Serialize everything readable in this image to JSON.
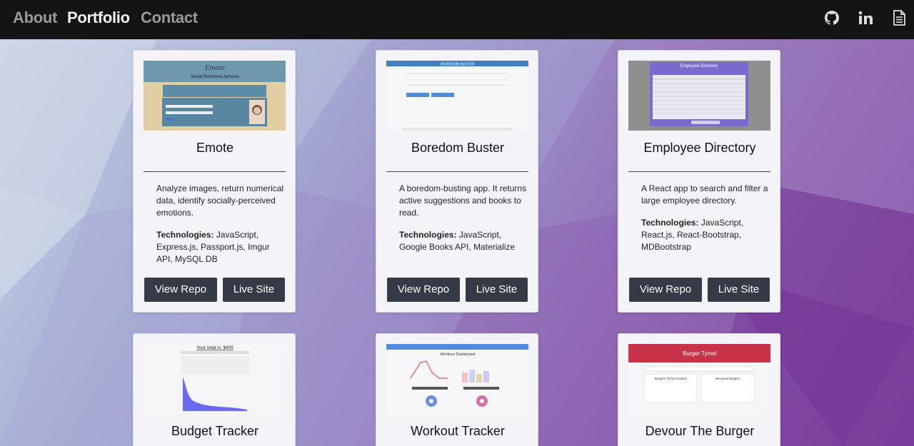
{
  "nav": {
    "links": [
      {
        "label": "About"
      },
      {
        "label": "Portfolio"
      },
      {
        "label": "Contact"
      }
    ],
    "icons": [
      "github-icon",
      "linkedin-icon",
      "resume-icon"
    ]
  },
  "colors": {
    "navbar_bg": "#141414",
    "button_bg": "#343a46",
    "card_bg": "#f4f4f8"
  },
  "projects": [
    {
      "title": "Emote",
      "description": "Analyze images, return numerical data, identify socially-perceived emotions.",
      "tech_label": "Technologies:",
      "technologies": "JavaScript, Express.js, Passport.js, Imgur API, MySQL DB",
      "repo_label": "View Repo",
      "live_label": "Live Site",
      "thumb_text": [
        "Emote",
        "Social Emotional Apnosia"
      ]
    },
    {
      "title": "Boredom Buster",
      "description": "A boredom-busting app. It returns active suggestions and books to read.",
      "tech_label": "Technologies:",
      "technologies": "JavaScript, Google Books API, Materialize",
      "repo_label": "View Repo",
      "live_label": "Live Site",
      "thumb_text": [
        "BOREDOM BUSTER"
      ]
    },
    {
      "title": "Employee Directory",
      "description": "A React app to search and filter a large employee directory.",
      "tech_label": "Technologies:",
      "technologies": "JavaScript, React.js, React-Bootstrap, MDBootstrap",
      "repo_label": "View Repo",
      "live_label": "Live Site",
      "thumb_text": [
        "Employee Directory"
      ]
    },
    {
      "title": "Budget Tracker",
      "thumb_text": [
        "Your total is: $405"
      ]
    },
    {
      "title": "Workout Tracker",
      "thumb_text": [
        "Workout Dashboard"
      ]
    },
    {
      "title": "Devour The Burger",
      "thumb_text": [
        "Burger Tyme!",
        "Burgers You've Created",
        "Devoured Burgers"
      ]
    }
  ]
}
